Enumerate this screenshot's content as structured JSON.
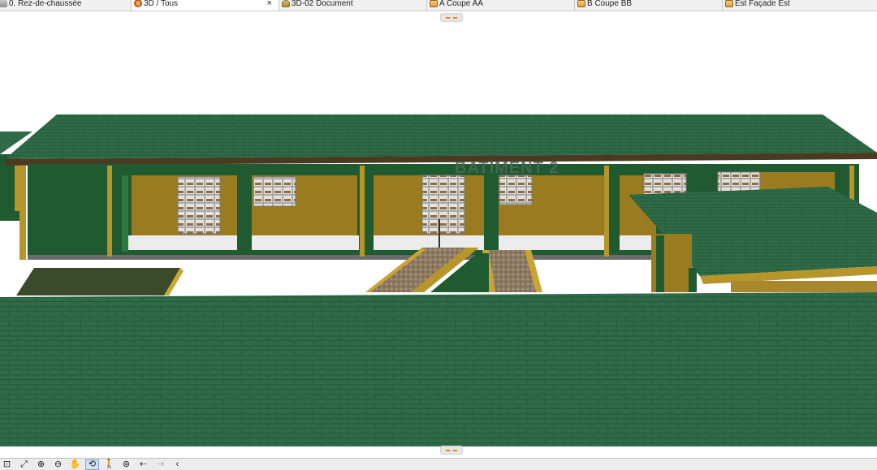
{
  "tabs": [
    {
      "label": "0. Rez-de-chaussée",
      "icon": "floor-plan-icon",
      "active": false
    },
    {
      "label": "3D / Tous",
      "icon": "3d-view-icon",
      "active": true,
      "close": "×"
    },
    {
      "label": "3D-02 Document",
      "icon": "3d-document-icon",
      "active": false
    },
    {
      "label": "A Coupe AA",
      "icon": "section-icon",
      "active": false
    },
    {
      "label": "B Coupe BB",
      "icon": "section-icon",
      "active": false
    },
    {
      "label": "Est Façade Est",
      "icon": "elevation-icon",
      "active": false
    }
  ],
  "viewport": {
    "sign": "BATIMENT 2",
    "colors": {
      "roof": "#2e6b45",
      "wall_green": "#1f5a31",
      "wall_ochre": "#9a7b1f",
      "trim": "#b6952a",
      "floor": "#e9e9e9"
    }
  },
  "toolbar": [
    {
      "name": "zoom-window-icon",
      "glyph": "⊡",
      "active": false
    },
    {
      "name": "fit-in-window-icon",
      "glyph": "⤢",
      "active": false
    },
    {
      "name": "zoom-in-icon",
      "glyph": "⊕",
      "active": false
    },
    {
      "name": "zoom-out-icon",
      "glyph": "⊖",
      "active": false
    },
    {
      "name": "pan-icon",
      "glyph": "✋",
      "active": false
    },
    {
      "name": "orbit-icon",
      "glyph": "⟲",
      "active": true
    },
    {
      "name": "walk-icon",
      "glyph": "🚶",
      "active": false
    },
    {
      "name": "explore-icon",
      "glyph": "⊛",
      "active": false
    },
    {
      "name": "previous-zoom-icon",
      "glyph": "⇠",
      "active": false
    },
    {
      "name": "next-zoom-icon",
      "glyph": "⇢",
      "active": false
    },
    {
      "name": "scroll-left-icon",
      "glyph": "‹",
      "active": false
    }
  ]
}
